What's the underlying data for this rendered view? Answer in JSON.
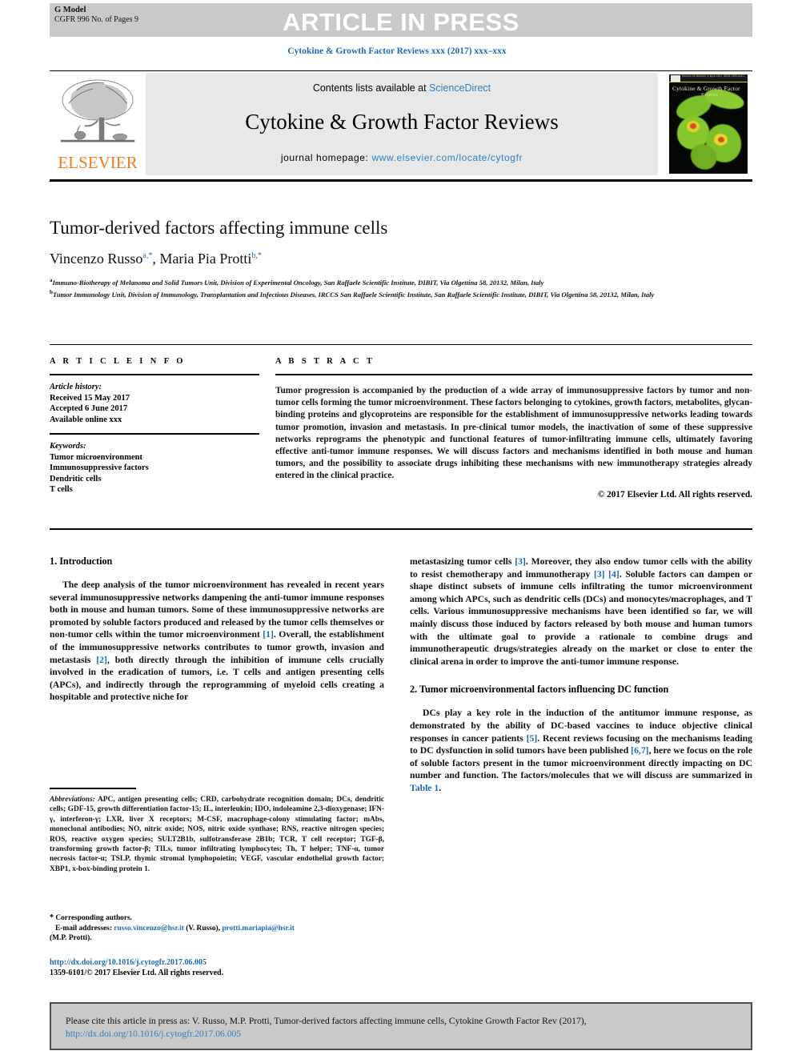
{
  "banner": {
    "g_model": "G Model",
    "g_model_sub": "CGFR 996 No. of Pages 9",
    "article_in_press": "ARTICLE IN PRESS"
  },
  "running_head": "Cytokine & Growth Factor Reviews xxx (2017) xxx–xxx",
  "masthead": {
    "publisher": "ELSEVIER",
    "contents_prefix": "Contents lists available at ",
    "contents_link": "ScienceDirect",
    "journal_title": "Cytokine & Growth Factor Reviews",
    "homepage_label": "journal homepage: ",
    "homepage_url": "www.elsevier.com/locate/cytogfr",
    "cover_title": "Cytokine & Growth Factor",
    "cover_subtitle": "Reviews",
    "cover_topbar": "Volume 34   Number 4   April 2017            ISSN 1359-6101"
  },
  "article": {
    "title": "Tumor-derived factors affecting immune cells",
    "authors_part1": "Vincenzo Russo",
    "authors_sup1": "a,*",
    "authors_sep": ", ",
    "authors_part2": "Maria Pia Protti",
    "authors_sup2": "b,*",
    "affiliation_a_sup": "a",
    "affiliation_a": "Immuno-Biotherapy of Melanoma and Solid Tumors Unit, Division of Experimental Oncology, San Raffaele Scientific Institute, DIBIT, Via Olgettina 58, 20132, Milan, Italy",
    "affiliation_b_sup": "b",
    "affiliation_b": "Tumor Immunology Unit, Division of Immunology, Transplantation and Infectious Diseases, IRCCS San Raffaele Scientific Institute, San Raffaele Scientific Institute, DIBIT, Via Olgettina 58, 20132, Milan, Italy"
  },
  "article_info": {
    "heading": "A R T I C L E  I N F O",
    "history_label": "Article history:",
    "received": "Received 15 May 2017",
    "accepted": "Accepted 6 June 2017",
    "available": "Available online xxx",
    "keywords_label": "Keywords:",
    "keywords": [
      "Tumor microenvironment",
      "Immunosuppressive factors",
      "Dendritic cells",
      "T cells"
    ]
  },
  "abstract": {
    "heading": "A B S T R A C T",
    "text": "Tumor progression is accompanied by the production of a wide array of immunosuppressive factors by tumor and non-tumor cells forming the tumor microenvironment. These factors belonging to cytokines, growth factors, metabolites, glycan-binding proteins and glycoproteins are responsible for the establishment of immunosuppressive networks leading towards tumor promotion, invasion and metastasis. In pre-clinical tumor models, the inactivation of some of these suppressive networks reprograms the phenotypic and functional features of tumor-infiltrating immune cells, ultimately favoring effective anti-tumor immune responses. We will discuss factors and mechanisms identified in both mouse and human tumors, and the possibility to associate drugs inhibiting these mechanisms with new immunotherapy strategies already entered in the clinical practice.",
    "copyright": "© 2017 Elsevier Ltd. All rights reserved."
  },
  "sections": {
    "intro_heading": "1. Introduction",
    "intro_p1_a": "The deep analysis of the tumor microenvironment has revealed in recent years several immunosuppressive networks dampening the anti-tumor immune responses both in mouse and human tumors. Some of these immunosuppressive networks are promoted by soluble factors produced and released by the tumor cells themselves or non-tumor cells within the tumor microenvironment ",
    "intro_ref1": "[1]",
    "intro_p1_b": ". Overall, the establishment of the immunosuppressive networks contributes to tumor growth, invasion and metastasis ",
    "intro_ref2": "[2]",
    "intro_p1_c": ", both directly through the inhibition of immune cells crucially involved in the eradication of tumors, i.e. T cells and antigen presenting cells (APCs), and indirectly through the reprogramming of myeloid cells creating a hospitable and protective niche for ",
    "right_p1_a": "metastasizing tumor cells ",
    "right_ref3": "[3]",
    "right_p1_b": ". Moreover, they also endow tumor cells with the ability to resist chemotherapy and immunotherapy ",
    "right_ref34": "[3] [4]",
    "right_p1_c": ". Soluble factors can dampen or shape distinct subsets of immune cells infiltrating the tumor microenvironment among which APCs, such as dendritic cells (DCs) and monocytes/macrophages, and T cells. Various immunosuppressive mechanisms have been identified so far, we will mainly discuss those induced by factors released by both mouse and human tumors with the ultimate goal to provide a rationale to combine drugs and immunotherapeutic drugs/strategies already on the market or close to enter the clinical arena in order to improve the anti-tumor immune response.",
    "dc_heading": "2. Tumor microenvironmental factors influencing DC function",
    "dc_p1_a": "DCs play a key role in the induction of the antitumor immune response, as demonstrated by the ability of DC-based vaccines to induce objective clinical responses in cancer patients ",
    "dc_ref5": "[5]",
    "dc_p1_b": ". Recent reviews focusing on the mechanisms leading to DC dysfunction in solid tumors have been published ",
    "dc_ref67": "[6,7]",
    "dc_p1_c": ", here we focus on the role of soluble factors present in the tumor microenvironment directly impacting on DC number and function. The factors/molecules that we will discuss are summarized in ",
    "dc_table_link": "Table 1",
    "dc_p1_d": "."
  },
  "footnotes": {
    "abbrev_label": "Abbreviations:",
    "abbrev_text": " APC, antigen presenting cells; CRD, carbohydrate recognition domain; DCs, dendritic cells; GDF-15, growth differentiation factor-15; IL, interleukin; IDO, indoleamine 2,3-dioxygenase; IFN-γ, interferon-γ; LXR, liver X receptors; M-CSF, macrophage-colony stimulating factor; mAbs, monoclonal antibodies; NO, nitric oxide; NOS, nitric oxide synthase; RNS, reactive nitrogen species; ROS, reactive oxygen species; SULT2B1b, sulfotransferase 2B1b; TCR, T cell receptor; TGF-β, transforming growth factor-β; TILs, tumor infiltrating lymphocytes; Th, T helper; TNF-α, tumor necrosis factor-α; TSLP, thymic stromal lymphopoietin; VEGF, vascular endothelial growth factor; XBP1, x-box-binding protein 1.",
    "corresponding": "Corresponding authors.",
    "email_label": "E-mail addresses:",
    "email1": "russo.vincenzo@hsr.it",
    "email1_owner": " (V. Russo), ",
    "email2": "protti.mariapia@hsr.it",
    "email2_owner": "(M.P. Protti).",
    "doi_url": "http://dx.doi.org/10.1016/j.cytogfr.2017.06.005",
    "issn_line": "1359-6101/© 2017 Elsevier Ltd. All rights reserved."
  },
  "cite_box": {
    "text": "Please cite this article in press as: V. Russo, M.P. Protti, Tumor-derived factors affecting immune cells, Cytokine Growth Factor Rev (2017),",
    "doi": "http://dx.doi.org/10.1016/j.cytogfr.2017.06.005"
  },
  "colors": {
    "link_blue": "#1a6bb5",
    "elsevier_orange": "#ef7c23",
    "banner_gray": "#c9c9c9",
    "panel_gray": "#e8e8e8"
  }
}
